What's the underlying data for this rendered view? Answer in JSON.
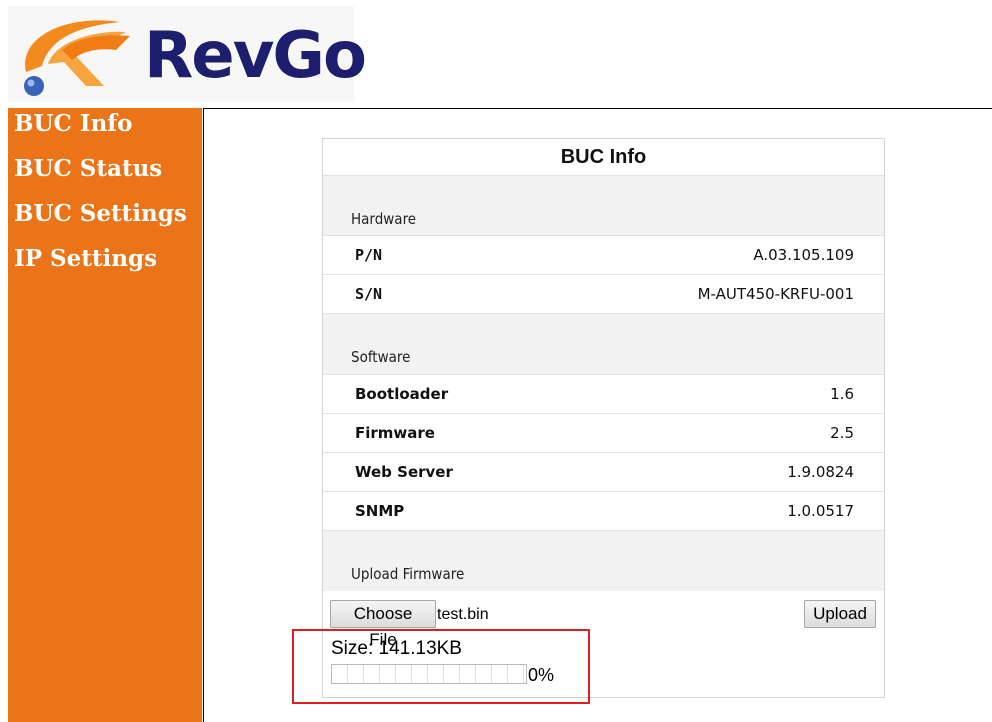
{
  "logo": {
    "text": "RevGo"
  },
  "nav": {
    "items": [
      {
        "label": "BUC Info"
      },
      {
        "label": "BUC Status"
      },
      {
        "label": "BUC Settings"
      },
      {
        "label": "IP Settings"
      }
    ]
  },
  "panel": {
    "title": "BUC Info",
    "hardware": {
      "heading": "Hardware",
      "rows": [
        {
          "label": "P/N",
          "value": "A.03.105.109"
        },
        {
          "label": "S/N",
          "value": "M-AUT450-KRFU-001"
        }
      ]
    },
    "software": {
      "heading": "Software",
      "rows": [
        {
          "label": "Bootloader",
          "value": "1.6"
        },
        {
          "label": "Firmware",
          "value": "2.5"
        },
        {
          "label": "Web Server",
          "value": "1.9.0824"
        },
        {
          "label": "SNMP",
          "value": "1.0.0517"
        }
      ]
    },
    "upload": {
      "heading": "Upload Firmware",
      "choose_label": "Choose File",
      "file_name": "test.bin",
      "upload_label": "Upload",
      "size_text": "Size: 141.13KB",
      "progress_fraction": 0,
      "progress_text": "0%"
    }
  },
  "colors": {
    "sidebar": "#ec7418",
    "logo_text": "#1d1f6e",
    "logo_swoosh": "#f28a1e",
    "highlight": "#e02020"
  },
  "icons": {
    "logo_mark": "revgo-logo-icon"
  }
}
